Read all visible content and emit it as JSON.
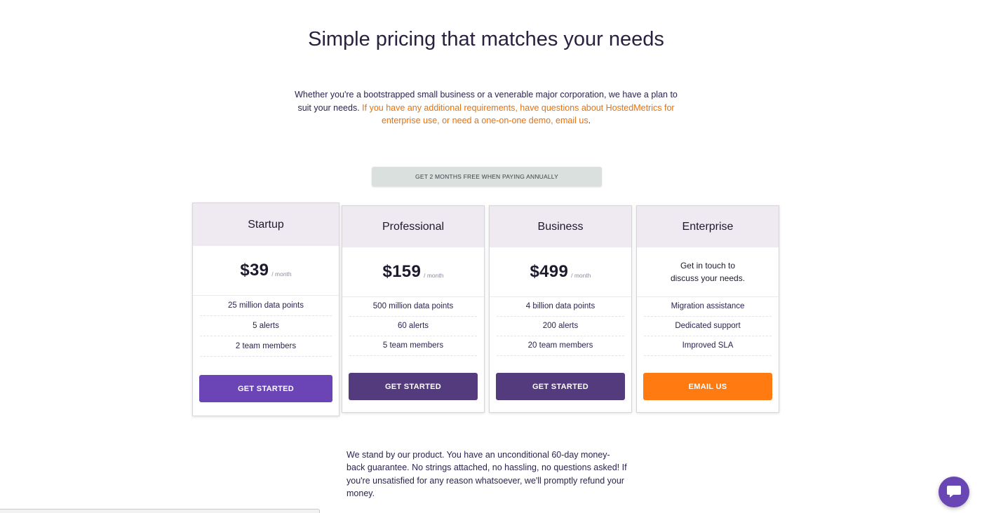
{
  "hero": {
    "title": "Simple pricing that matches your needs",
    "intro_part1": "Whether you're a bootstrapped small business or a venerable major corporation, we have a plan to suit your needs.",
    "intro_part2": " If you have any additional requirements, have questions about HostedMetrics for enterprise use, or need a one-on-one demo,",
    "intro_link": "email us",
    "intro_end": "."
  },
  "promo": {
    "label": "GET 2 MONTHS FREE WHEN PAYING ANNUALLY"
  },
  "plans": [
    {
      "name": "Startup",
      "price": "$39",
      "per": "/ month",
      "features": [
        "25 million data points",
        "5 alerts",
        "2 team members"
      ],
      "button": "GET STARTED"
    },
    {
      "name": "Professional",
      "price": "$159",
      "per": "/ month",
      "features": [
        "500 million data points",
        "60 alerts",
        "5 team members"
      ],
      "button": "GET STARTED"
    },
    {
      "name": "Business",
      "price": "$499",
      "per": "/ month",
      "features": [
        "4 billion data points",
        "200 alerts",
        "20 team members"
      ],
      "button": "GET STARTED"
    },
    {
      "name": "Enterprise",
      "contact_line1": "Get in touch to",
      "contact_line2": "discuss your needs.",
      "features": [
        "Migration assistance",
        "Dedicated support",
        "Improved SLA"
      ],
      "button": "EMAIL US"
    }
  ],
  "guarantee": {
    "text": "We stand by our product. You have an unconditional 60-day money-back guarantee. No strings attached, no hassling, no questions asked! If you're unsatisfied for any reason whatsoever, we'll promptly refund your money."
  },
  "colors": {
    "accent_orange": "#ff7a10",
    "primary_purple": "#543b7e",
    "highlight_violet": "#6b45b6"
  },
  "icons": {
    "chat": "chat-bubble-icon"
  }
}
